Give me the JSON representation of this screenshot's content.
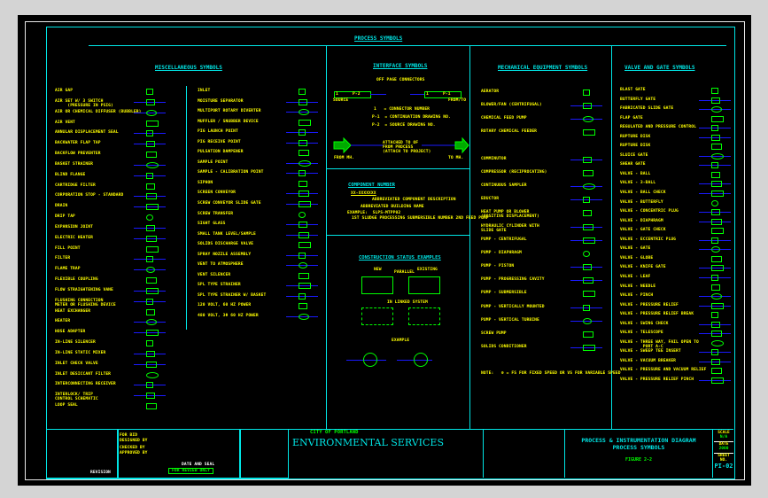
{
  "title": "PROCESS SYMBOLS",
  "colors": {
    "frame": "#00e5e5",
    "text": "#ffff00",
    "symbol": "#00ff00",
    "pipe": "#1a1aff",
    "accent": "#ff00ff"
  },
  "misc": {
    "heading": "MISCELLANEOUS SYMBOLS",
    "left": [
      "AIR GAP",
      "AIR SET W/ 3 SWITCH\n     (PRESSURE IN PSIG)",
      "AIR OR CHEMICAL DIFFUSER (BUBBLER)",
      "AIR VENT",
      "ANNULAR DISPLACEMENT SEAL",
      "BACKWATER FLAP TAP",
      "BACKFLOW PREVENTER",
      "BASKET STRAINER",
      "BLIND FLANGE",
      "CARTRIDGE FILTER",
      "CORPORATION STOP - STANDARD",
      "DRAIN",
      "DRIP TAP",
      "EXPANSION JOINT",
      "ELECTRIC HEATER",
      "FILL POINT",
      "FILTER",
      "FLAME TRAP",
      "FLEXIBLE COUPLING",
      "FLOW STRAIGHTENING VANE",
      "FLUSHING CONNECTION\nMETER OR FLUSHING DEVICE",
      "HEAT EXCHANGER",
      "HEATER",
      "HOSE ADAPTER",
      "IN-LINE SILENCER",
      "IN-LINE STATIC MIXER",
      "INLET CHECK VALVE",
      "INLET DESICCANT FILTER",
      "INTERCONNECTING RECEIVER",
      "INTERLOCK/ TRIP\nCONTROL SCHEMATIC",
      "LOOP SEAL"
    ],
    "right": [
      "INLET",
      "MOISTURE SEPARATOR",
      "MULTIPORT ROTARY DIVERTER",
      "MUFFLER / SNUBBER DEVICE",
      "PIG LAUNCH POINT",
      "PIG RECEIVE POINT",
      "PULSATION DAMPENER",
      "SAMPLE POINT",
      "SAMPLE - CALIBRATION POINT",
      "SIPHON",
      "SCREEN CONVEYOR",
      "SCREW CONVEYOR SLIDE GATE",
      "SCREW TRANSFER",
      "SIGHT GLASS",
      "SMALL TANK LEVEL/SAMPLE",
      "SOLIDS DISCHARGE VALVE",
      "SPRAY NOZZLE ASSEMBLY",
      "VENT TO ATMOSPHERE",
      "VENT SILENCER",
      "SPL TYPE STRAINER",
      "SPL TYPE STRAINER W/ BASKET",
      "120 VOLT, 60 HZ POWER",
      "480 VOLT, 3Φ 60 HZ POWER"
    ]
  },
  "interface": {
    "heading": "INTERFACE SYMBOLS",
    "subheading": "OFF PAGE CONNECTORS",
    "tag_left": "P-2",
    "tag_right": "P-1",
    "num": "1",
    "from_label": "SOURCE",
    "to_label": "FROM/TO",
    "legend": [
      "1   = CONNECTOR NUMBER",
      "P-1  = CONTINUATION DRAWING NO.",
      "P-2  = SOURCE DRAWING NO."
    ],
    "arrow_text": "ATTACHED TO OF\nFROM PROCESS\n(ATTACH TO PROJECT)",
    "arrow_left": "FROM MH.",
    "arrow_right": "TO MH.",
    "component_heading": "COMPONENT NUMBER",
    "component_code": "XX-XXXXXXX",
    "component_desc": "ABBREVIATED COMPONENT DESCRIPTION",
    "component_area": "ABBREVIATED BUILDING NAME",
    "example": "EXAMPLE:  SLPS-MTPP02",
    "example_desc": "1ST SLUDGE PROCESSING SUBMERSIBLE NUMBER 2ND FEED PUMP"
  },
  "construction": {
    "heading": "CONSTRUCTION STATUS EXAMPLES",
    "new": "NEW",
    "existing": "EXISTING",
    "parallel": "PARALLEL",
    "future": "IN LINKED SYSTEM",
    "example": "EXAMPLE"
  },
  "mechanical": {
    "heading": "MECHANICAL EQUIPMENT SYMBOLS",
    "items": [
      "AERATOR",
      "BLOWER/FAN (CENTRIFUGAL)",
      "CHEMICAL FEED PUMP",
      "ROTARY CHEMICAL FEEDER",
      "",
      "COMMINUTOR",
      "COMPRESSOR (RECIPROCATING)",
      "CONTINUOUS SAMPLER",
      "EDUCTOR",
      "HEAT PUMP OR BLOWER\n(POSITIVE DISPLACEMENT)",
      "HYDRAULIC CYLINDER WITH\nSLIDE GATE",
      "PUMP - CENTRIFUGAL",
      "PUMP - DIAPHRAGM",
      "PUMP - PISTON",
      "PUMP - PROGRESSING CAVITY",
      "PUMP - SUBMERSIBLE",
      "PUMP - VERTICALLY MOUNTED",
      "PUMP - VERTICAL TURBINE",
      "SCREW PUMP",
      "SOLIDS CONDITIONER"
    ],
    "note": "NOTE:   ⊕ = FS FOR FIXED SPEED OR VS FOR VARIABLE SPEED"
  },
  "valves": {
    "heading": "VALVE AND GATE SYMBOLS",
    "items": [
      "BLAST GATE",
      "BUTTERFLY GATE",
      "FABRICATED SLIDE GATE",
      "FLAP GATE",
      "REGULATED AND PRESSURE CONTROL",
      "RUPTURE DISK",
      "RUPTURE DISK",
      "SLUICE GATE",
      "SHEAR GATE",
      "VALVE - BALL",
      "VALVE - 3-BALL",
      "VALVE - BALL CHECK",
      "VALVE - BUTTERFLY",
      "VALVE - CONCENTRIC PLUG",
      "VALVE - DIAPHRAGM",
      "VALVE - GATE CHECK",
      "VALVE - ECCENTRIC PLUG",
      "VALVE - GATE",
      "VALVE - GLOBE",
      "VALVE - KNIFE GATE",
      "VALVE - LEAF",
      "VALVE - NEEDLE",
      "VALVE - PINCH",
      "VALVE - PRESSURE RELIEF",
      "VALVE - PRESSURE RELIEF BREAK",
      "VALVE - SWING CHECK",
      "VALVE - TELESCOPE",
      "VALVE - THREE WAY, FAIL OPEN TO\n         PORT A-C",
      "VALVE - SWEEP TEE INSERT",
      "VALVE - VACUUM BREAKER",
      "VALVE - PRESSURE AND VACUUM RELIEF",
      "VALVE - PRESSURE RELIEF PINCH"
    ]
  },
  "titleblock": {
    "revision": "REVISION",
    "city": "CITY OF PORTLAND",
    "bureau": "ENVIRONMENTAL SERVICES",
    "fields": [
      "FOR BID",
      "DESIGNED BY",
      "CHECKED BY",
      "APPROVED BY"
    ],
    "dwg_title_1": "PROCESS & INSTRUMENTATION DIAGRAM",
    "dwg_title_2": "PROCESS SYMBOLS",
    "figure": "FIGURE 2-2",
    "scale_label": "SCALE",
    "scale": "N/A",
    "date_label": "DATE",
    "date": "2000",
    "sheet_label": "SHEET NO.",
    "sheet": "PI-02",
    "stamp_title": "DATE AND SEAL",
    "stamp": "FOR REVIEW ONLY"
  }
}
